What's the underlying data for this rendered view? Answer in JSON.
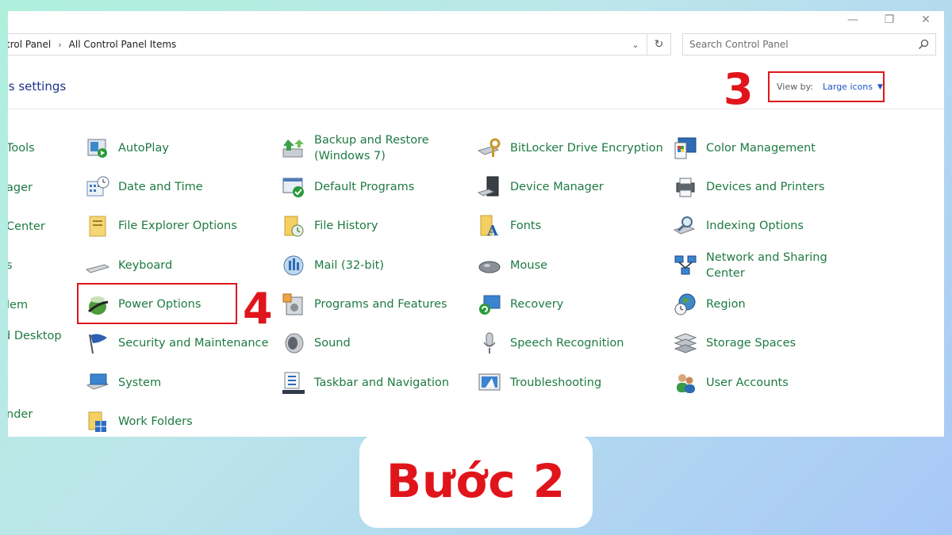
{
  "window": {
    "controls": {
      "minimize": "—",
      "restore": "❐",
      "close": "✕"
    },
    "breadcrumb": [
      "trol Panel",
      "All Control Panel Items"
    ],
    "breadcrumb_sep": "›",
    "refresh_glyph": "↻",
    "dropdown_glyph": "⌄"
  },
  "search": {
    "placeholder": "Search Control Panel"
  },
  "heading": "’s settings",
  "view_by": {
    "label": "View by:",
    "value": "Large icons",
    "caret": "▼"
  },
  "annotations": {
    "step3": "3",
    "step4": "4"
  },
  "partial_items": [
    "Tools",
    "ager",
    "Center",
    "s",
    "lem",
    "d Desktop",
    "nder"
  ],
  "items": [
    {
      "label": "AutoPlay",
      "icon": "autoplay-icon"
    },
    {
      "label": "Backup and Restore (Windows 7)",
      "icon": "backup-restore-icon"
    },
    {
      "label": "BitLocker Drive Encryption",
      "icon": "bitlocker-icon"
    },
    {
      "label": "Color Management",
      "icon": "color-management-icon"
    },
    {
      "label": "Date and Time",
      "icon": "date-time-icon"
    },
    {
      "label": "Default Programs",
      "icon": "default-programs-icon"
    },
    {
      "label": "Device Manager",
      "icon": "device-manager-icon"
    },
    {
      "label": "Devices and Printers",
      "icon": "printer-icon"
    },
    {
      "label": "File Explorer Options",
      "icon": "file-explorer-icon"
    },
    {
      "label": "File History",
      "icon": "file-history-icon"
    },
    {
      "label": "Fonts",
      "icon": "fonts-icon"
    },
    {
      "label": "Indexing Options",
      "icon": "indexing-icon"
    },
    {
      "label": "Keyboard",
      "icon": "keyboard-icon"
    },
    {
      "label": "Mail (32-bit)",
      "icon": "mail-icon"
    },
    {
      "label": "Mouse",
      "icon": "mouse-icon"
    },
    {
      "label": "Network and Sharing Center",
      "icon": "network-icon"
    },
    {
      "label": "Power Options",
      "icon": "power-options-icon"
    },
    {
      "label": "Programs and Features",
      "icon": "programs-features-icon"
    },
    {
      "label": "Recovery",
      "icon": "recovery-icon"
    },
    {
      "label": "Region",
      "icon": "region-icon"
    },
    {
      "label": "Security and Maintenance",
      "icon": "security-flag-icon"
    },
    {
      "label": "Sound",
      "icon": "speaker-icon"
    },
    {
      "label": "Speech Recognition",
      "icon": "microphone-icon"
    },
    {
      "label": "Storage Spaces",
      "icon": "storage-icon"
    },
    {
      "label": "System",
      "icon": "system-icon"
    },
    {
      "label": "Taskbar and Navigation",
      "icon": "taskbar-icon"
    },
    {
      "label": "Troubleshooting",
      "icon": "troubleshooting-icon"
    },
    {
      "label": "User Accounts",
      "icon": "user-accounts-icon"
    },
    {
      "label": "Work Folders",
      "icon": "work-folders-icon"
    }
  ],
  "caption": "Bước 2",
  "colors": {
    "link": "#1e7a42",
    "accent_red": "#e0151b",
    "heading": "#1e3287"
  }
}
